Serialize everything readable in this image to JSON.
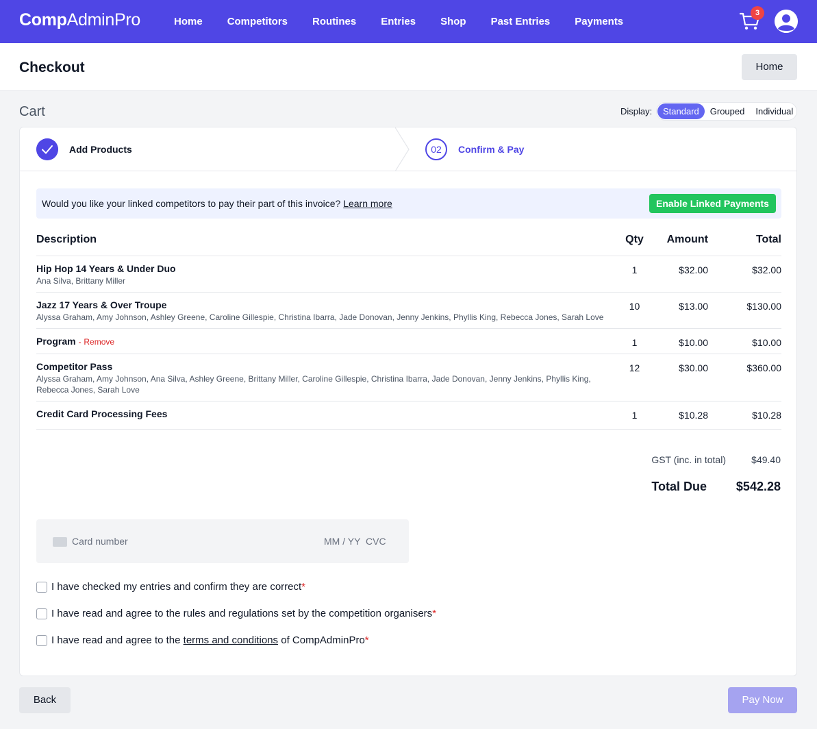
{
  "nav": {
    "brand_bold": "Comp",
    "brand_rest": "AdminPro",
    "links": [
      "Home",
      "Competitors",
      "Routines",
      "Entries",
      "Shop",
      "Past Entries",
      "Payments"
    ],
    "cart_count": "3"
  },
  "header": {
    "title": "Checkout",
    "home_button": "Home"
  },
  "cart": {
    "title": "Cart",
    "display_label": "Display:",
    "display_options": [
      "Standard",
      "Grouped",
      "Individual"
    ],
    "selected_option": "Standard"
  },
  "steps": {
    "step1": "Add Products",
    "step2_number": "02",
    "step2": "Confirm & Pay"
  },
  "linked_payments": {
    "text": "Would you like your linked competitors to pay their part of this invoice?",
    "link": "Learn more",
    "button": "Enable Linked Payments"
  },
  "table": {
    "headers": {
      "description": "Description",
      "qty": "Qty",
      "amount": "Amount",
      "total": "Total"
    },
    "rows": [
      {
        "title": "Hip Hop 14 Years & Under Duo",
        "names": "Ana Silva, Brittany Miller",
        "qty": "1",
        "amount": "$32.00",
        "total": "$32.00"
      },
      {
        "title": "Jazz 17 Years & Over Troupe",
        "names": "Alyssa Graham, Amy Johnson, Ashley Greene, Caroline Gillespie, Christina Ibarra, Jade Donovan, Jenny Jenkins, Phyllis King, Rebecca Jones, Sarah Love",
        "qty": "10",
        "amount": "$13.00",
        "total": "$130.00"
      },
      {
        "title": "Program",
        "dash": "-",
        "remove": "Remove",
        "qty": "1",
        "amount": "$10.00",
        "total": "$10.00"
      },
      {
        "title": "Competitor Pass",
        "names": "Alyssa Graham, Amy Johnson, Ana Silva, Ashley Greene, Brittany Miller, Caroline Gillespie, Christina Ibarra, Jade Donovan, Jenny Jenkins, Phyllis King, Rebecca Jones, Sarah Love",
        "qty": "12",
        "amount": "$30.00",
        "total": "$360.00"
      },
      {
        "title": "Credit Card Processing Fees",
        "qty": "1",
        "amount": "$10.28",
        "total": "$10.28"
      }
    ]
  },
  "summary": {
    "gst_label": "GST (inc. in total)",
    "gst_value": "$49.40",
    "total_label": "Total Due",
    "total_value": "$542.28"
  },
  "payment": {
    "card_placeholder": "Card number",
    "expiry_placeholder": "MM / YY",
    "cvc_placeholder": "CVC"
  },
  "checks": {
    "c1": "I have checked my entries and confirm they are correct",
    "c2": "I have read and agree to the rules and regulations set by the competition organisers",
    "c3_before": "I have read and agree to the",
    "c3_link": "terms and conditions",
    "c3_after": "of CompAdminPro",
    "required_mark": "*"
  },
  "footer": {
    "back": "Back",
    "pay": "Pay Now"
  },
  "colors": {
    "primary": "#4f46e5",
    "success": "#22c55e",
    "danger": "#dc2626"
  }
}
